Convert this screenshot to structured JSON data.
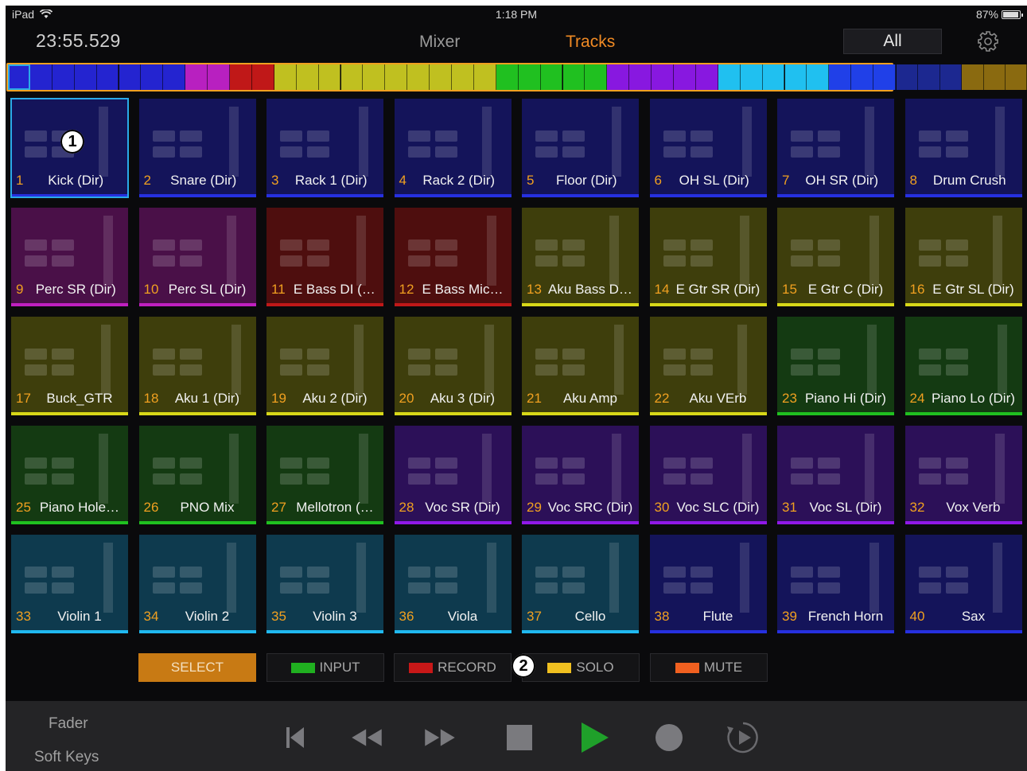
{
  "status_bar": {
    "device": "iPad",
    "time": "1:18 PM",
    "battery": "87%"
  },
  "header": {
    "timecode": "23:55.529",
    "tab_mixer": "Mixer",
    "tab_tracks": "Tracks",
    "filter": "All"
  },
  "colors": {
    "accent": "#f08a24",
    "selection": "#2aaae8",
    "blue": "#2424c8",
    "magenta": "#c020c0",
    "red": "#c01818",
    "yellow": "#c0c020",
    "green": "#20c020",
    "purple": "#8818e0",
    "cyan": "#20c0f0"
  },
  "color_strip": [
    "#2424d0",
    "#2424d0",
    "#2424d0",
    "#2424d0",
    "#2424d0",
    "#2424d0",
    "#2424d0",
    "#2424d0",
    "#b820c0",
    "#b820c0",
    "#c01818",
    "#c01818",
    "#c0c020",
    "#c0c020",
    "#c0c020",
    "#c0c020",
    "#c0c020",
    "#c0c020",
    "#c0c020",
    "#c0c020",
    "#c0c020",
    "#c0c020",
    "#20c020",
    "#20c020",
    "#20c020",
    "#20c020",
    "#20c020",
    "#8818e0",
    "#8818e0",
    "#8818e0",
    "#8818e0",
    "#8818e0",
    "#20c0f0",
    "#20c0f0",
    "#20c0f0",
    "#20c0f0",
    "#20c0f0",
    "#2040e8",
    "#2040e8",
    "#2040e8",
    "#1c2890",
    "#1c2890",
    "#1c2890",
    "#8a6a10",
    "#8a6a10",
    "#8a6a10"
  ],
  "tracks": [
    {
      "n": "1",
      "name": "Kick (Dir)",
      "color": "blue"
    },
    {
      "n": "2",
      "name": "Snare (Dir)",
      "color": "blue"
    },
    {
      "n": "3",
      "name": "Rack 1 (Dir)",
      "color": "blue"
    },
    {
      "n": "4",
      "name": "Rack 2 (Dir)",
      "color": "blue"
    },
    {
      "n": "5",
      "name": "Floor (Dir)",
      "color": "blue"
    },
    {
      "n": "6",
      "name": "OH SL (Dir)",
      "color": "blue"
    },
    {
      "n": "7",
      "name": "OH SR (Dir)",
      "color": "blue"
    },
    {
      "n": "8",
      "name": "Drum Crush",
      "color": "blue"
    },
    {
      "n": "9",
      "name": "Perc SR (Dir)",
      "color": "magenta"
    },
    {
      "n": "10",
      "name": "Perc SL (Dir)",
      "color": "magenta"
    },
    {
      "n": "11",
      "name": "E Bass DI (…",
      "color": "red"
    },
    {
      "n": "12",
      "name": "E Bass Mic…",
      "color": "red"
    },
    {
      "n": "13",
      "name": "Aku Bass D…",
      "color": "yellow"
    },
    {
      "n": "14",
      "name": "E Gtr SR (Dir)",
      "color": "yellow"
    },
    {
      "n": "15",
      "name": "E Gtr C (Dir)",
      "color": "yellow"
    },
    {
      "n": "16",
      "name": "E Gtr SL (Dir)",
      "color": "yellow"
    },
    {
      "n": "17",
      "name": "Buck_GTR",
      "color": "yellow"
    },
    {
      "n": "18",
      "name": "Aku 1 (Dir)",
      "color": "yellow"
    },
    {
      "n": "19",
      "name": "Aku 2 (Dir)",
      "color": "yellow"
    },
    {
      "n": "20",
      "name": "Aku 3 (Dir)",
      "color": "yellow"
    },
    {
      "n": "21",
      "name": "Aku Amp",
      "color": "yellow"
    },
    {
      "n": "22",
      "name": "Aku VErb",
      "color": "yellow"
    },
    {
      "n": "23",
      "name": "Piano Hi (Dir)",
      "color": "green"
    },
    {
      "n": "24",
      "name": "Piano Lo (Dir)",
      "color": "green"
    },
    {
      "n": "25",
      "name": "Piano Hole…",
      "color": "green"
    },
    {
      "n": "26",
      "name": "PNO Mix",
      "color": "green"
    },
    {
      "n": "27",
      "name": "Mellotron (…",
      "color": "green"
    },
    {
      "n": "28",
      "name": "Voc SR (Dir)",
      "color": "purple"
    },
    {
      "n": "29",
      "name": "Voc SRC (Dir)",
      "color": "purple"
    },
    {
      "n": "30",
      "name": "Voc SLC (Dir)",
      "color": "purple"
    },
    {
      "n": "31",
      "name": "Voc SL (Dir)",
      "color": "purple"
    },
    {
      "n": "32",
      "name": "Vox Verb",
      "color": "purple"
    },
    {
      "n": "33",
      "name": "Violin 1",
      "color": "cyan"
    },
    {
      "n": "34",
      "name": "Violin 2",
      "color": "cyan"
    },
    {
      "n": "35",
      "name": "Violin 3",
      "color": "cyan"
    },
    {
      "n": "36",
      "name": "Viola",
      "color": "cyan"
    },
    {
      "n": "37",
      "name": "Cello",
      "color": "cyan"
    },
    {
      "n": "38",
      "name": "Flute",
      "color": "blue"
    },
    {
      "n": "39",
      "name": "French Horn",
      "color": "blue"
    },
    {
      "n": "40",
      "name": "Sax",
      "color": "blue"
    }
  ],
  "modes": [
    {
      "label": "SELECT",
      "swatch": "",
      "active": true
    },
    {
      "label": "INPUT",
      "swatch": "#20b020",
      "active": false
    },
    {
      "label": "RECORD",
      "swatch": "#c81818",
      "active": false
    },
    {
      "label": "SOLO",
      "swatch": "#f0c020",
      "active": false
    },
    {
      "label": "MUTE",
      "swatch": "#f06020",
      "active": false
    }
  ],
  "sidebar": {
    "fader": "Fader",
    "soft_keys": "Soft Keys"
  },
  "transport": {
    "icons": [
      "return-to-start-icon",
      "rewind-icon",
      "fast-forward-icon",
      "stop-icon",
      "play-icon",
      "record-icon",
      "loop-play-icon"
    ],
    "play_color": "#1fa02a"
  },
  "callouts": {
    "one": "1",
    "two": "2"
  }
}
